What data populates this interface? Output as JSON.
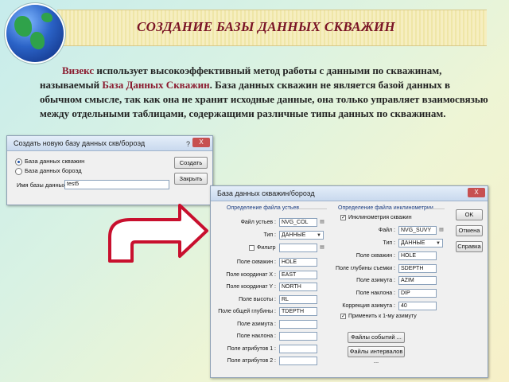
{
  "header": {
    "title": "СОЗДАНИЕ БАЗЫ ДАННЫХ СКВАЖИН"
  },
  "intro": {
    "p1": "Визекс",
    "p2": " использует высокоэффективный метод работы с данными по скважинам, называемый ",
    "p3": "База Данных Скважин",
    "p4": ". База данных скважин не является базой данных в обычном смысле, так как она не хранит исходные данные, она только управляет взаимосвязью между отдельными таблицами, содержащими различные типы данных по скважинам."
  },
  "dialog_create": {
    "title": "Создать новую базу данных скв/бороэд",
    "help": "?",
    "close": "X",
    "radio1": "База данных скважин",
    "radio2": "База данных бороэд",
    "name_label": "Имя базы данных :",
    "name_value": "test5",
    "create_btn": "Создать",
    "close_btn": "Закрыть"
  },
  "dialog_db": {
    "title": "База данных скважин/бороэд",
    "close": "X",
    "collar_group": "Определение файла устьев",
    "incl_group": "Определение файла инклинометрии",
    "file_label": "Файл устьев :",
    "file_value": "NVG_COL",
    "type_label": "Тип :",
    "type_value": "ДАННЫЕ",
    "filter_label": "Фильтр",
    "fields": [
      {
        "label": "Поле скважин :",
        "value": "HOLE"
      },
      {
        "label": "Поле координат X :",
        "value": "EAST"
      },
      {
        "label": "Поле координат Y :",
        "value": "NORTH"
      },
      {
        "label": "Поле высоты :",
        "value": "RL"
      },
      {
        "label": "Поле общей глубины :",
        "value": "TDEPTH"
      },
      {
        "label": "Поле азимута :",
        "value": ""
      },
      {
        "label": "Поле наклона :",
        "value": ""
      },
      {
        "label": "Поле атрибутов 1 :",
        "value": ""
      },
      {
        "label": "Поле атрибутов 2 :",
        "value": ""
      }
    ],
    "incl_check": "Инклинометрия скважин",
    "incl_file_label": "Файл :",
    "incl_file_value": "NVG_SUVY",
    "incl_type_label": "Тип :",
    "incl_type_value": "ДАННЫЕ",
    "incl_fields": [
      {
        "label": "Поле скважин :",
        "value": "HOLE"
      },
      {
        "label": "Поле глубины съемки :",
        "value": "SDEPTH"
      },
      {
        "label": "Поле азимута :",
        "value": "AZIM"
      },
      {
        "label": "Поле наклона :",
        "value": "DIP"
      }
    ],
    "corr_label": "Коррекция азимута :",
    "corr_value": "40",
    "apply_check": "Применить к 1-му азимуту",
    "events_btn": "Файлы событий ...",
    "intervals_btn": "Файлы интервалов ...",
    "ok_btn": "OK",
    "cancel_btn": "Отмена",
    "help_btn": "Справка"
  }
}
